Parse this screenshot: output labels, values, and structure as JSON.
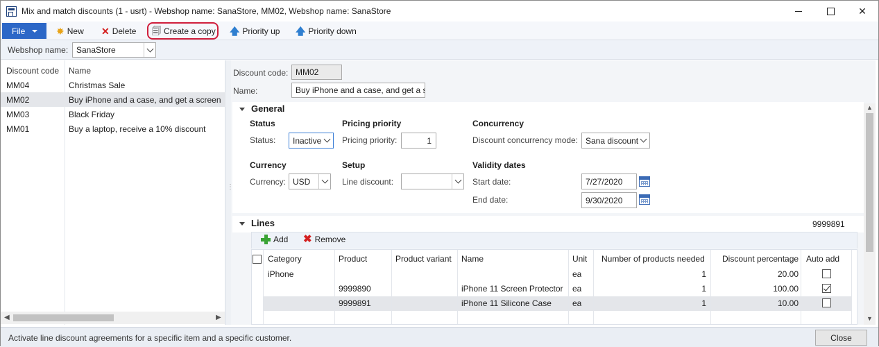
{
  "window": {
    "title": "Mix and match discounts (1 - usrt) - Webshop name: SanaStore, MM02, Webshop name: SanaStore",
    "controls": {
      "minimize": "",
      "maximize": "",
      "close": "✕"
    }
  },
  "toolbar": {
    "file_label": "File",
    "new_label": "New",
    "delete_label": "Delete",
    "copy_label": "Create a copy",
    "priority_up_label": "Priority up",
    "priority_down_label": "Priority down",
    "help_label": "?"
  },
  "filter": {
    "label": "Webshop name:",
    "value": "SanaStore"
  },
  "list": {
    "headers": {
      "code": "Discount code",
      "name": "Name"
    },
    "rows": [
      {
        "code": "MM04",
        "name": "Christmas Sale",
        "selected": false
      },
      {
        "code": "MM02",
        "name": "Buy iPhone and a case, and get a screen ...",
        "selected": true
      },
      {
        "code": "MM03",
        "name": "Black Friday",
        "selected": false
      },
      {
        "code": "MM01",
        "name": "Buy a laptop, receive a 10% discount",
        "selected": false
      }
    ]
  },
  "detail": {
    "code_label": "Discount code:",
    "code_value": "MM02",
    "name_label": "Name:",
    "name_value": "Buy iPhone and a case, and get a s"
  },
  "general": {
    "title": "General",
    "status_group": "Status",
    "status_label": "Status:",
    "status_value": "Inactive",
    "pricing_group": "Pricing priority",
    "pricing_label": "Pricing priority:",
    "pricing_value": "1",
    "concurrency_group": "Concurrency",
    "concurrency_label": "Discount concurrency mode:",
    "concurrency_value": "Sana discount",
    "currency_group": "Currency",
    "currency_label": "Currency:",
    "currency_value": "USD",
    "setup_group": "Setup",
    "line_discount_label": "Line discount:",
    "line_discount_value": "",
    "validity_group": "Validity dates",
    "start_label": "Start date:",
    "start_value": "7/27/2020",
    "end_label": "End date:",
    "end_value": "9/30/2020"
  },
  "lines": {
    "title": "Lines",
    "summary": "9999891",
    "add_label": "Add",
    "remove_label": "Remove",
    "columns": {
      "category": "Category",
      "product": "Product",
      "variant": "Product variant",
      "name": "Name",
      "unit": "Unit",
      "needed": "Number of products needed",
      "discount": "Discount percentage",
      "auto_add": "Auto add"
    },
    "rows": [
      {
        "category": "iPhone",
        "product": "",
        "variant": "",
        "name": "",
        "unit": "ea",
        "needed": "1",
        "discount": "20.00",
        "auto_add": false
      },
      {
        "category": "",
        "product": "9999890",
        "variant": "",
        "name": "iPhone 11 Screen Protector",
        "unit": "ea",
        "needed": "1",
        "discount": "100.00",
        "auto_add": true
      },
      {
        "category": "",
        "product": "9999891",
        "variant": "",
        "name": "iPhone 11 Silicone Case",
        "unit": "ea",
        "needed": "1",
        "discount": "10.00",
        "auto_add": false
      }
    ]
  },
  "status_bar": {
    "text": "Activate line discount agreements for a specific item and a specific customer.",
    "close_label": "Close"
  },
  "colors": {
    "file_button": "#2c67c7",
    "highlight_ring": "#d01e3c"
  }
}
